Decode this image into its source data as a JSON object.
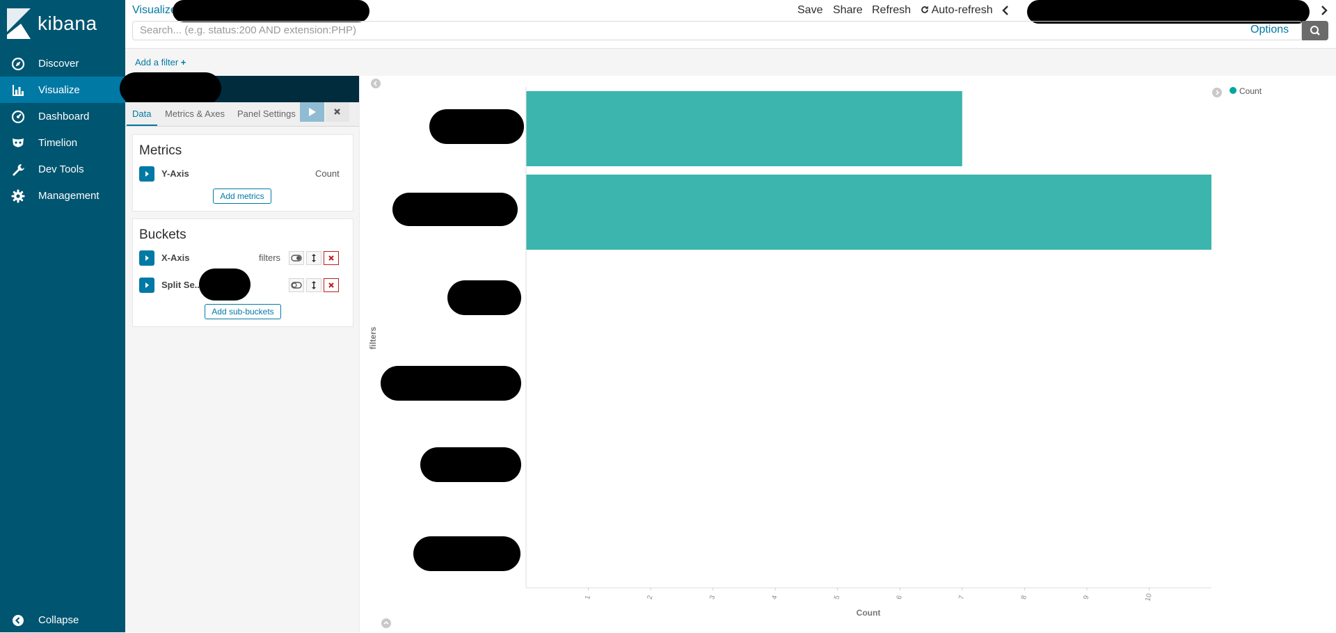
{
  "app": {
    "logo_text": "kibana"
  },
  "sidebar": {
    "items": [
      {
        "label": "Discover",
        "icon": "compass-icon",
        "active": false
      },
      {
        "label": "Visualize",
        "icon": "bar-chart-icon",
        "active": true
      },
      {
        "label": "Dashboard",
        "icon": "gauge-icon",
        "active": false
      },
      {
        "label": "Timelion",
        "icon": "mask-icon",
        "active": false
      },
      {
        "label": "Dev Tools",
        "icon": "wrench-icon",
        "active": false
      },
      {
        "label": "Management",
        "icon": "gear-icon",
        "active": false
      }
    ],
    "collapse_label": "Collapse"
  },
  "topbar": {
    "breadcrumb": "Visualize",
    "save": "Save",
    "share": "Share",
    "refresh": "Refresh",
    "auto_refresh": "Auto-refresh"
  },
  "search": {
    "placeholder": "Search... (e.g. status:200 AND extension:PHP)",
    "value": "",
    "options_label": "Options"
  },
  "filter_bar": {
    "add_filter": "Add a filter"
  },
  "editor": {
    "tabs": [
      "Data",
      "Metrics & Axes",
      "Panel Settings"
    ],
    "active_tab": "Data",
    "metrics": {
      "title": "Metrics",
      "rows": [
        {
          "label": "Y-Axis",
          "value": "Count"
        }
      ],
      "add_button": "Add metrics"
    },
    "buckets": {
      "title": "Buckets",
      "rows": [
        {
          "label": "X-Axis",
          "value": "filters"
        },
        {
          "label": "Split Se...",
          "value": ""
        }
      ],
      "add_button": "Add sub-buckets"
    }
  },
  "colors": {
    "bar": "#3bb5ae",
    "sidebar": "#005571",
    "active": "#0079a5"
  },
  "chart_data": {
    "type": "bar",
    "orientation": "horizontal",
    "ylabel": "filters",
    "xlabel": "Count",
    "categories": [
      "",
      "",
      "",
      "",
      "",
      ""
    ],
    "series": [
      {
        "name": "Count",
        "values": [
          7,
          11,
          0,
          0,
          0,
          0
        ]
      }
    ],
    "x_ticks": [
      "1",
      "2",
      "3",
      "4",
      "5",
      "6",
      "7",
      "8",
      "9",
      "10"
    ],
    "xlim": [
      0,
      11
    ],
    "legend": "top-right",
    "grid": false
  }
}
